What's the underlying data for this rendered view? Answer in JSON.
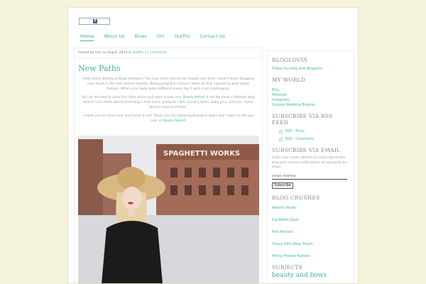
{
  "search": {
    "label": "search"
  },
  "nav": [
    {
      "label": "Home"
    },
    {
      "label": "About Us"
    },
    {
      "label": "Bows"
    },
    {
      "label": "DIY"
    },
    {
      "label": "Outfits"
    },
    {
      "label": "Contact Us"
    }
  ],
  "post": {
    "meta_prefix": "Posted by",
    "author": "star",
    "date_text": "on Aug 8, 2014 in",
    "category": "Outfits",
    "sep": "|",
    "comments": "2 comments",
    "title": "New Paths",
    "para1": "Hello lovely Beauty & Bows followers. You may have noticed (or maybe not) that I haven't been blogging very much in the last several months. Being pregnant I haven't been all that inspired to post about fashion. When your body looks different every day it gets a bit challenging.",
    "para2_a": "So I've decided to close this little space and open a new one,",
    "para2_link": "Dearly Noted",
    "para2_b": ". It will be more a lifestyle blog where I can share about becoming a new mom, products I like, nursery tours, baby pics, and yes...some fashion here and there.",
    "para3_a": "I invite you to come over and check it out! Thank you for following Beauty & Bows and I hope to see you over at",
    "para3_link": "Dearly Noted",
    "para3_b": "!",
    "photo_sign": "SPAGHETTI WORKS"
  },
  "sidebar": {
    "bloglovin_title": "BLOGLOVIN",
    "bloglovin_link": "Follow my blog with Bloglovin",
    "myworld_title": "MY WORLD",
    "myworld_links": [
      "Etsy",
      "Pinterest",
      "Instagram",
      "Custom Wedding Bowties"
    ],
    "rss_title": "SUBSCRIBE VIA RSS FEED",
    "rss_items": [
      "RSS - Posts",
      "RSS - Comments"
    ],
    "email_title": "SUBSCRIBE VIA EMAIL",
    "email_text": "Enter your email address to subscribe to this blog and receive notifications of new posts by email.",
    "email_placeholder": "Email Address",
    "subscribe_label": "Subscribe",
    "crushes_title": "BLOG CRUSHES",
    "crushes": [
      "Atlantic Pacific",
      "Gal Meets Glam",
      "Pink Peonies",
      "Classy Girls Wear Pearls",
      "Penny Pincher Fashion"
    ],
    "subjects_title": "SUBJECTS",
    "subjects_tag": "beauty and bows"
  }
}
